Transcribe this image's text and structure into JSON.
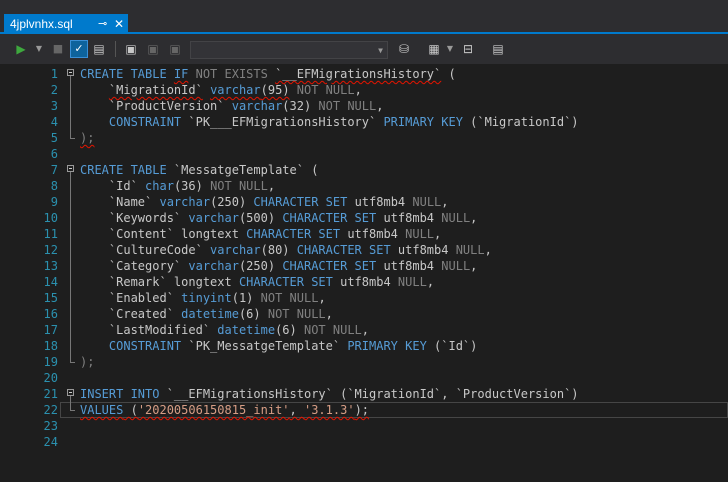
{
  "tab": {
    "filename": "4jplvnhx.sql",
    "pin_icon": "pin-icon",
    "close_icon": "close-icon"
  },
  "toolbar": {
    "execute_icon": "play-icon",
    "cancel_icon": "stop-icon",
    "parse_icon": "checkmark-icon",
    "results_icon": "document-icon",
    "connect_icons": [
      "connect-icon",
      "disconnect-icon",
      "change-connection-icon"
    ],
    "database_value": "",
    "other_icons": [
      "database-icon",
      "results-grid-icon",
      "execution-plan-icon",
      "options-icon"
    ]
  },
  "editor": {
    "lines": [
      {
        "n": "1",
        "fold": "start",
        "tokens": [
          [
            "k",
            "CREATE TABLE "
          ],
          [
            "k sq",
            "IF"
          ],
          [
            "g",
            " NOT EXISTS "
          ],
          [
            "p sq",
            "`__EFMigrationsHistory`"
          ],
          [
            "p",
            " ("
          ]
        ]
      },
      {
        "n": "2",
        "fold": "line",
        "tokens": [
          [
            "p",
            "    "
          ],
          [
            "p sq",
            "`MigrationId`"
          ],
          [
            "p",
            " "
          ],
          [
            "k sq",
            "varchar"
          ],
          [
            "p sq",
            "(95)"
          ],
          [
            "g",
            " NOT NULL"
          ],
          [
            "p",
            ","
          ]
        ]
      },
      {
        "n": "3",
        "fold": "line",
        "tokens": [
          [
            "p",
            "    `ProductVersion` "
          ],
          [
            "k",
            "varchar"
          ],
          [
            "p",
            "(32) "
          ],
          [
            "g",
            "NOT NULL"
          ],
          [
            "p",
            ","
          ]
        ]
      },
      {
        "n": "4",
        "fold": "line",
        "tokens": [
          [
            "p",
            "    "
          ],
          [
            "k",
            "CONSTRAINT"
          ],
          [
            "p",
            " `PK___EFMigrationsHistory` "
          ],
          [
            "k",
            "PRIMARY KEY"
          ],
          [
            "p",
            " (`MigrationId`)"
          ]
        ]
      },
      {
        "n": "5",
        "fold": "end",
        "tokens": [
          [
            "g sq",
            ");"
          ]
        ]
      },
      {
        "n": "6",
        "fold": "",
        "tokens": []
      },
      {
        "n": "7",
        "fold": "start",
        "tokens": [
          [
            "k",
            "CREATE TABLE"
          ],
          [
            "p",
            " `MessatgeTemplate` ("
          ]
        ]
      },
      {
        "n": "8",
        "fold": "line",
        "tokens": [
          [
            "p",
            "    `Id` "
          ],
          [
            "k",
            "char"
          ],
          [
            "p",
            "(36) "
          ],
          [
            "g",
            "NOT NULL"
          ],
          [
            "p",
            ","
          ]
        ]
      },
      {
        "n": "9",
        "fold": "line",
        "tokens": [
          [
            "p",
            "    `Name` "
          ],
          [
            "k",
            "varchar"
          ],
          [
            "p",
            "(250) "
          ],
          [
            "k",
            "CHARACTER SET"
          ],
          [
            "p",
            " utf8mb4 "
          ],
          [
            "g",
            "NULL"
          ],
          [
            "p",
            ","
          ]
        ]
      },
      {
        "n": "10",
        "fold": "line",
        "tokens": [
          [
            "p",
            "    `Keywords` "
          ],
          [
            "k",
            "varchar"
          ],
          [
            "p",
            "(500) "
          ],
          [
            "k",
            "CHARACTER SET"
          ],
          [
            "p",
            " utf8mb4 "
          ],
          [
            "g",
            "NULL"
          ],
          [
            "p",
            ","
          ]
        ]
      },
      {
        "n": "11",
        "fold": "line",
        "tokens": [
          [
            "p",
            "    `Content` longtext "
          ],
          [
            "k",
            "CHARACTER SET"
          ],
          [
            "p",
            " utf8mb4 "
          ],
          [
            "g",
            "NULL"
          ],
          [
            "p",
            ","
          ]
        ]
      },
      {
        "n": "12",
        "fold": "line",
        "tokens": [
          [
            "p",
            "    `CultureCode` "
          ],
          [
            "k",
            "varchar"
          ],
          [
            "p",
            "(80) "
          ],
          [
            "k",
            "CHARACTER SET"
          ],
          [
            "p",
            " utf8mb4 "
          ],
          [
            "g",
            "NULL"
          ],
          [
            "p",
            ","
          ]
        ]
      },
      {
        "n": "13",
        "fold": "line",
        "tokens": [
          [
            "p",
            "    `Category` "
          ],
          [
            "k",
            "varchar"
          ],
          [
            "p",
            "(250) "
          ],
          [
            "k",
            "CHARACTER SET"
          ],
          [
            "p",
            " utf8mb4 "
          ],
          [
            "g",
            "NULL"
          ],
          [
            "p",
            ","
          ]
        ]
      },
      {
        "n": "14",
        "fold": "line",
        "tokens": [
          [
            "p",
            "    `Remark` longtext "
          ],
          [
            "k",
            "CHARACTER SET"
          ],
          [
            "p",
            " utf8mb4 "
          ],
          [
            "g",
            "NULL"
          ],
          [
            "p",
            ","
          ]
        ]
      },
      {
        "n": "15",
        "fold": "line",
        "tokens": [
          [
            "p",
            "    `Enabled` "
          ],
          [
            "k",
            "tinyint"
          ],
          [
            "p",
            "(1) "
          ],
          [
            "g",
            "NOT NULL"
          ],
          [
            "p",
            ","
          ]
        ]
      },
      {
        "n": "16",
        "fold": "line",
        "tokens": [
          [
            "p",
            "    `Created` "
          ],
          [
            "k",
            "datetime"
          ],
          [
            "p",
            "(6) "
          ],
          [
            "g",
            "NOT NULL"
          ],
          [
            "p",
            ","
          ]
        ]
      },
      {
        "n": "17",
        "fold": "line",
        "tokens": [
          [
            "p",
            "    `LastModified` "
          ],
          [
            "k",
            "datetime"
          ],
          [
            "p",
            "(6) "
          ],
          [
            "g",
            "NOT NULL"
          ],
          [
            "p",
            ","
          ]
        ]
      },
      {
        "n": "18",
        "fold": "line",
        "tokens": [
          [
            "p",
            "    "
          ],
          [
            "k",
            "CONSTRAINT"
          ],
          [
            "p",
            " `PK_MessatgeTemplate` "
          ],
          [
            "k",
            "PRIMARY KEY"
          ],
          [
            "p",
            " (`Id`)"
          ]
        ]
      },
      {
        "n": "19",
        "fold": "end",
        "tokens": [
          [
            "g",
            ");"
          ]
        ]
      },
      {
        "n": "20",
        "fold": "",
        "tokens": []
      },
      {
        "n": "21",
        "fold": "start",
        "tokens": [
          [
            "k",
            "INSERT INTO"
          ],
          [
            "p",
            " `__EFMigrationsHistory` (`MigrationId`, `ProductVersion`)"
          ]
        ]
      },
      {
        "n": "22",
        "fold": "end",
        "cursor": true,
        "tokens": [
          [
            "k sq",
            "VALUES"
          ],
          [
            "p sq",
            " ("
          ],
          [
            "s sq",
            "'20200506150815_init'"
          ],
          [
            "p sq",
            ", "
          ],
          [
            "s sq",
            "'3.1.3'"
          ],
          [
            "p sq",
            ");"
          ]
        ]
      },
      {
        "n": "23",
        "fold": "",
        "tokens": []
      },
      {
        "n": "24",
        "fold": "",
        "tokens": []
      }
    ]
  }
}
